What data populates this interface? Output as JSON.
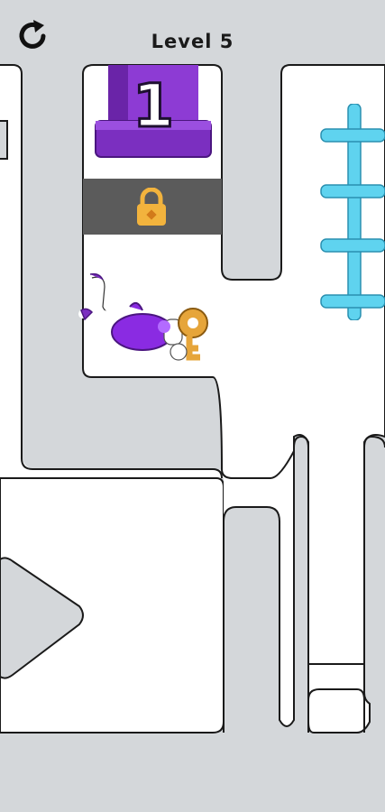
{
  "hud": {
    "level_label": "Level 5",
    "restart_icon": "restart-icon"
  },
  "pedestal": {
    "number": "1",
    "color": "#7b2fc0"
  },
  "lock": {
    "icon": "padlock-icon",
    "bar_color": "#5b5b5b",
    "lock_color": "#f2b33d"
  },
  "ladder": {
    "icon": "ladder",
    "color": "#5fd3ef"
  },
  "character": {
    "icon": "purple-character-lying",
    "color": "#8a2be2",
    "key_color": "#e6a53a"
  },
  "colors": {
    "wall": "#d4d7da",
    "floor": "#ffffff",
    "outline": "#1a1a1a"
  }
}
